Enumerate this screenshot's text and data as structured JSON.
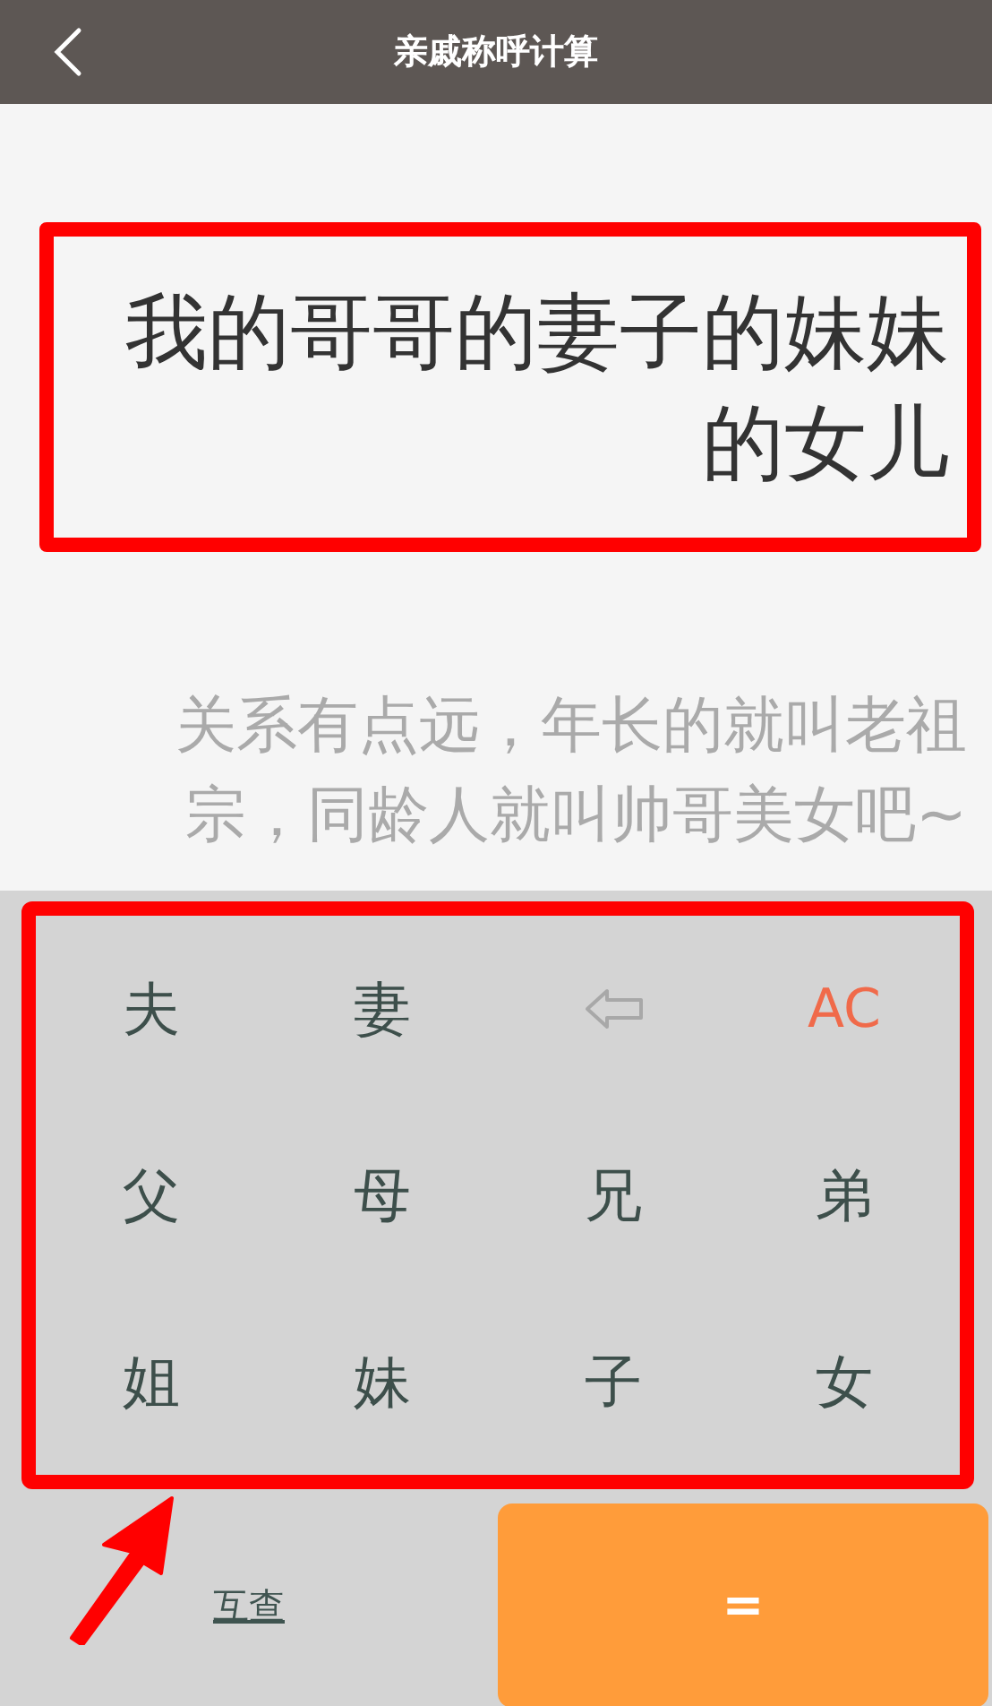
{
  "header": {
    "title": "亲戚称呼计算"
  },
  "expression": "我的哥哥的妻子的妹妹的女儿",
  "hint": "关系有点远，年长的就叫老祖宗，同龄人就叫帅哥美女吧~",
  "keys": [
    {
      "kind": "relation",
      "label": "夫"
    },
    {
      "kind": "relation",
      "label": "妻"
    },
    {
      "kind": "backspace"
    },
    {
      "kind": "clear",
      "label": "AC"
    },
    {
      "kind": "relation",
      "label": "父"
    },
    {
      "kind": "relation",
      "label": "母"
    },
    {
      "kind": "relation",
      "label": "兄"
    },
    {
      "kind": "relation",
      "label": "弟"
    },
    {
      "kind": "relation",
      "label": "姐"
    },
    {
      "kind": "relation",
      "label": "妹"
    },
    {
      "kind": "relation",
      "label": "子"
    },
    {
      "kind": "relation",
      "label": "女"
    }
  ],
  "mutual_button": "互查",
  "equals_button": "="
}
